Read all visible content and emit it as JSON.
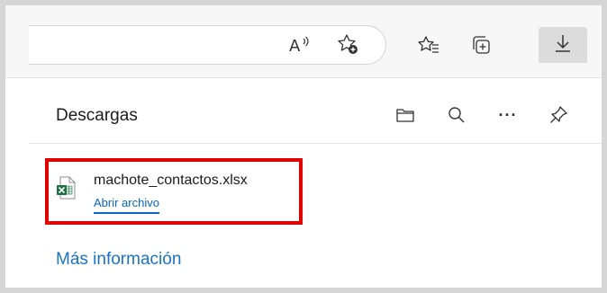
{
  "toolbar": {
    "read_aloud_text": "A",
    "icons": [
      "read-aloud-icon",
      "add-favorite-icon",
      "favorites-icon",
      "collections-icon",
      "downloads-icon"
    ]
  },
  "panel": {
    "title": "Descargas",
    "icons": [
      "open-folder-icon",
      "search-icon",
      "more-options-icon",
      "pin-icon"
    ],
    "more_options_glyph": "···"
  },
  "download": {
    "file_name": "machote_contactos.xlsx",
    "action_label": "Abrir archivo",
    "file_icon": "excel-file-icon"
  },
  "footer": {
    "more_info_label": "Más información"
  },
  "colors": {
    "highlight": "#e00000",
    "link": "#0a66c2",
    "excel_green": "#1e7145"
  }
}
